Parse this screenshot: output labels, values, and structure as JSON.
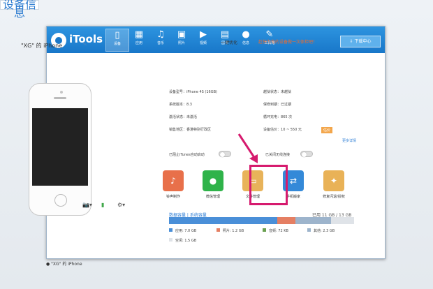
{
  "app": {
    "title": "iTools",
    "download": "⇩ 下载中心",
    "device_name": "\"XG\" 的 iPhone"
  },
  "nav": [
    {
      "label": "设备",
      "icon": "phone-icon",
      "glyph": "▯"
    },
    {
      "label": "应用",
      "icon": "apps-icon",
      "glyph": "▦"
    },
    {
      "label": "音乐",
      "icon": "music-icon",
      "glyph": "♫"
    },
    {
      "label": "照片",
      "icon": "photo-icon",
      "glyph": "▣"
    },
    {
      "label": "视频",
      "icon": "video-icon",
      "glyph": "▶"
    },
    {
      "label": "图书",
      "icon": "book-icon",
      "glyph": "▤"
    },
    {
      "label": "信息",
      "icon": "contact-icon",
      "glyph": "●"
    },
    {
      "label": "工具箱",
      "icon": "tools-icon",
      "glyph": "✎"
    }
  ],
  "tabs": {
    "device_info": "设备信息",
    "optimize": "一键优化",
    "promo": "趁快为你的设备做一次体检吧！"
  },
  "info": [
    {
      "k": "设备型号：",
      "v": "iPhone 4S (16GB)"
    },
    {
      "k": "越狱状态：",
      "v": "未越狱"
    },
    {
      "k": "系统版本：",
      "v": "8.3"
    },
    {
      "k": "保修到期：",
      "v": "已过期"
    },
    {
      "k": "激活状态：",
      "v": "未激活"
    },
    {
      "k": "循环充电：",
      "v": "865 次"
    },
    {
      "k": "销售地区：",
      "v": "香港特别行政区"
    },
    {
      "k": "设备估价：",
      "v": "10 ~ 550 元"
    }
  ],
  "more": "更多详情",
  "toggles": {
    "left": "已阻止iTunes自动启动",
    "right": "已关闭无线连接"
  },
  "apps": [
    {
      "label": "铃声制作",
      "icon": "bell-icon",
      "glyph": "♪",
      "color": "#e8704a"
    },
    {
      "label": "微信管理",
      "icon": "wechat-icon",
      "glyph": "●",
      "color": "#2fb34a"
    },
    {
      "label": "文件管理",
      "icon": "folder-icon",
      "glyph": "▭",
      "color": "#e8b35a"
    },
    {
      "label": "手机搬家",
      "icon": "transfer-icon",
      "glyph": "⇄",
      "color": "#3489d8"
    },
    {
      "label": "修复闪退/授权",
      "icon": "repair-icon",
      "glyph": "✦",
      "color": "#e9b257"
    }
  ],
  "storage": {
    "tabs": "数据容量 | 系统容量",
    "used": "已用 11 GB / 13 GB",
    "legend": [
      {
        "label": "应用: 7.0 GB",
        "color": "#4a8fd8",
        "value": 7.0
      },
      {
        "label": "照片: 1.2 GB",
        "color": "#e57f63",
        "value": 1.2
      },
      {
        "label": "音频: 72 KB",
        "color": "#6aa050",
        "value": 0.0
      },
      {
        "label": "其他: 2.3 GB",
        "color": "#9db4cc",
        "value": 2.3
      },
      {
        "label": "空闲: 1.5 GB",
        "color": "#dfe3e8",
        "value": 1.5
      }
    ]
  },
  "status": "\"XG\" 的 iPhone",
  "toolbar": {
    "camera": "📷▾",
    "battery": "▮",
    "gear": "⚙▾"
  }
}
